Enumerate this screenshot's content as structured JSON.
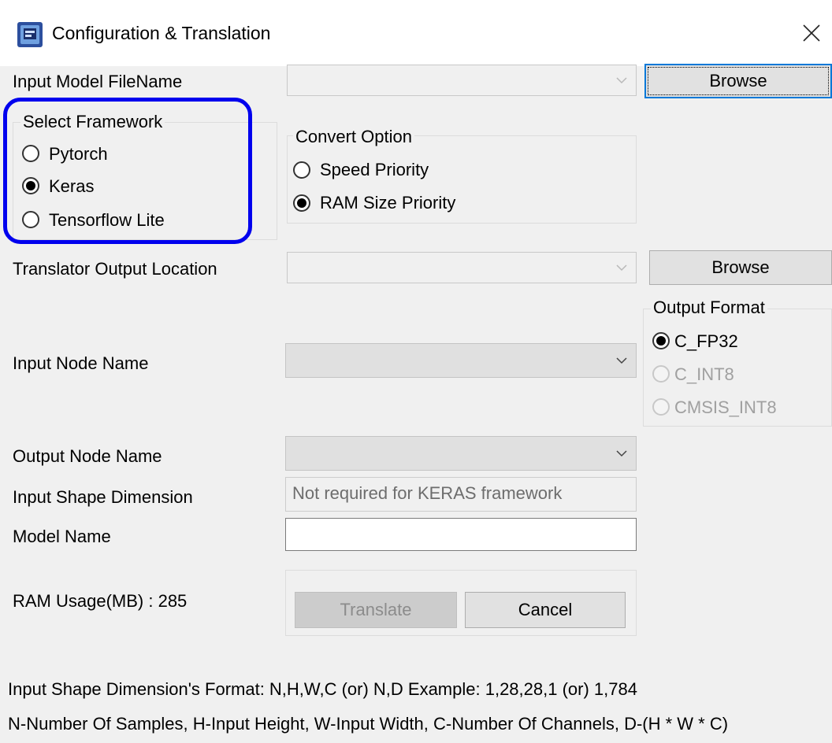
{
  "window": {
    "title": "Configuration & Translation",
    "app_icon": "chip-icon",
    "close_icon": "close-icon"
  },
  "input_model": {
    "label": "Input Model FileName",
    "value": "",
    "browse_label": "Browse"
  },
  "framework": {
    "title": "Select Framework",
    "options": [
      {
        "label": "Pytorch",
        "checked": false
      },
      {
        "label": "Keras",
        "checked": true
      },
      {
        "label": "Tensorflow Lite",
        "checked": false
      }
    ],
    "highlight_color": "#0000ee"
  },
  "convert_option": {
    "title": "Convert Option",
    "options": [
      {
        "label": "Speed Priority",
        "checked": false
      },
      {
        "label": "RAM Size Priority",
        "checked": true
      }
    ]
  },
  "translator_output": {
    "label": "Translator Output Location",
    "value": "",
    "browse_label": "Browse"
  },
  "output_format": {
    "title": "Output Format",
    "options": [
      {
        "label": "C_FP32",
        "checked": true,
        "enabled": true
      },
      {
        "label": "C_INT8",
        "checked": false,
        "enabled": false
      },
      {
        "label": "CMSIS_INT8",
        "checked": false,
        "enabled": false
      }
    ]
  },
  "input_node": {
    "label": "Input Node Name",
    "value": ""
  },
  "output_node": {
    "label": "Output Node Name",
    "value": ""
  },
  "input_shape": {
    "label": "Input Shape Dimension",
    "value": "Not required for KERAS framework"
  },
  "model_name": {
    "label": "Model Name",
    "value": ""
  },
  "ram_usage": {
    "text": "RAM Usage(MB) : 285"
  },
  "actions": {
    "translate_label": "Translate",
    "cancel_label": "Cancel"
  },
  "footer": {
    "line1": "Input Shape Dimension's Format: N,H,W,C (or) N,D    Example: 1,28,28,1 (or) 1,784",
    "line2": "N-Number Of Samples, H-Input Height, W-Input Width, C-Number Of Channels, D-(H * W * C)"
  }
}
